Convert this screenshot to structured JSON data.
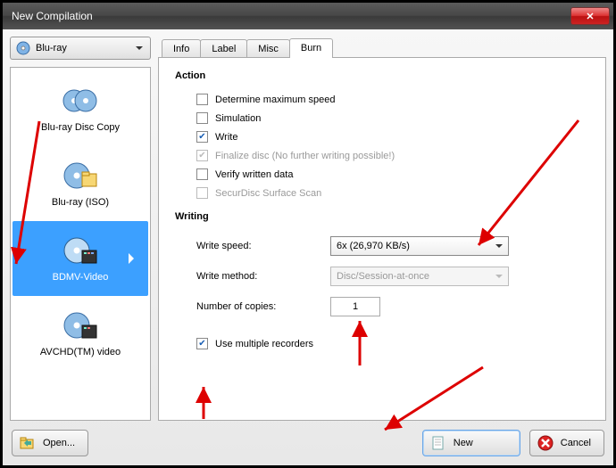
{
  "window": {
    "title": "New Compilation"
  },
  "type_selector": {
    "label": "Blu-ray",
    "icon": "disc-icon"
  },
  "sidebar": {
    "items": [
      {
        "label": "Blu-ray Disc Copy",
        "icon": "disc-copy-icon"
      },
      {
        "label": "Blu-ray (ISO)",
        "icon": "disc-iso-icon"
      },
      {
        "label": "BDMV-Video",
        "icon": "disc-video-icon",
        "selected": true
      },
      {
        "label": "AVCHD(TM) video",
        "icon": "disc-avchd-icon"
      }
    ]
  },
  "tabs": [
    {
      "label": "Info"
    },
    {
      "label": "Label"
    },
    {
      "label": "Misc"
    },
    {
      "label": "Burn",
      "active": true
    }
  ],
  "panel": {
    "action": {
      "heading": "Action",
      "options": [
        {
          "label": "Determine maximum speed",
          "checked": false,
          "enabled": true
        },
        {
          "label": "Simulation",
          "checked": false,
          "enabled": true
        },
        {
          "label": "Write",
          "checked": true,
          "enabled": true
        },
        {
          "label": "Finalize disc (No further writing possible!)",
          "checked": true,
          "enabled": false
        },
        {
          "label": "Verify written data",
          "checked": false,
          "enabled": true
        },
        {
          "label": "SecurDisc Surface Scan",
          "checked": false,
          "enabled": false
        }
      ]
    },
    "writing": {
      "heading": "Writing",
      "speed_label": "Write speed:",
      "speed_value": "6x (26,970 KB/s)",
      "method_label": "Write method:",
      "method_value": "Disc/Session-at-once",
      "copies_label": "Number of copies:",
      "copies_value": "1",
      "multi_label": "Use multiple recorders",
      "multi_checked": true
    }
  },
  "buttons": {
    "open": "Open...",
    "new": "New",
    "cancel": "Cancel"
  }
}
